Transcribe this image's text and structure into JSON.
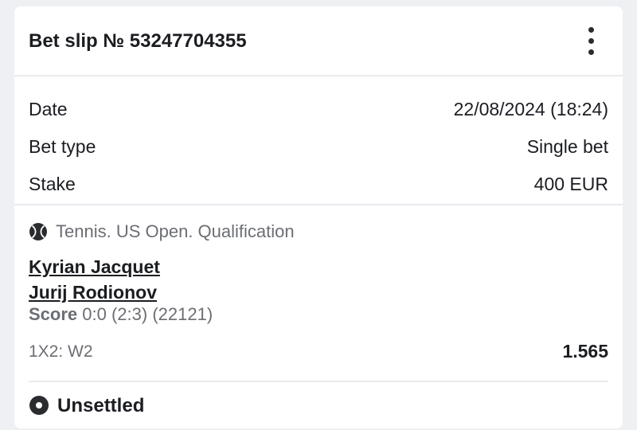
{
  "header": {
    "title": "Bet slip № 53247704355",
    "menu_icon": "more-vertical-icon"
  },
  "info": {
    "rows": [
      {
        "label": "Date",
        "value": "22/08/2024 (18:24)"
      },
      {
        "label": "Bet type",
        "value": "Single bet"
      },
      {
        "label": "Stake",
        "value": "400 EUR"
      }
    ]
  },
  "event": {
    "sport_icon": "tennis-ball-icon",
    "league": "Tennis. US Open. Qualification",
    "team1": "Kyrian Jacquet",
    "team2": "Jurij Rodionov",
    "score_label": "Score",
    "score_value": "0:0 (2:3) (22121)",
    "market": "1X2: W2",
    "odds": "1.565"
  },
  "status": {
    "icon": "record-circle-icon",
    "label": "Unsettled"
  },
  "colors": {
    "background": "#eef0f3",
    "card": "#ffffff",
    "text_primary": "#1b1d21",
    "text_secondary": "#6b6e74",
    "divider": "#e8eaed"
  }
}
